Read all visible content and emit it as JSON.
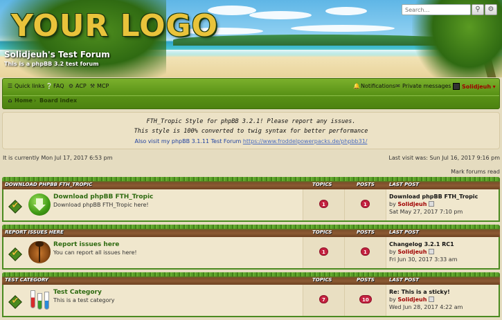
{
  "header": {
    "logo_text": "YOUR LOGO",
    "site_title": "Solidjeuh's Test Forum",
    "site_description": "This is a phpBB 3.2 test forum",
    "search_placeholder": "Search…"
  },
  "navbar": {
    "quick_links": "Quick links",
    "faq": "FAQ",
    "acp": "ACP",
    "mcp": "MCP",
    "notifications": "Notifications",
    "private_messages": "Private messages",
    "username": "Solidjeuh",
    "breadcrumb_home": "Home",
    "breadcrumb_index": "Board index"
  },
  "announcement": {
    "line1": "FTH_Tropic Style for phpBB 3.2.1! Please report any issues.",
    "line2": "This style is 100% converted to twig syntax for better performance",
    "line3_prefix": "Also visit my phpBB 3.1.11 Test Forum",
    "line3_link": "https://www.froddelpowerpacks.de/phpbb31/"
  },
  "info": {
    "current_time": "It is currently Mon Jul 17, 2017 6:53 pm",
    "last_visit": "Last visit was: Sun Jul 16, 2017 9:16 pm",
    "mark_read": "Mark forums read"
  },
  "columns": {
    "topics": "TOPICS",
    "posts": "POSTS",
    "last_post": "LAST POST"
  },
  "categories": [
    {
      "name": "DOWNLOAD PHPBB FTH_TROPIC",
      "forum_title": "Download phpBB FTH_Tropic",
      "forum_desc": "Download phpBB FTH_Tropic here!",
      "topics": "1",
      "posts": "1",
      "last_post_title": "Download phpBB FTH_Tropic",
      "by": "by",
      "author": "Solidjeuh",
      "time": "Sat May 27, 2017 7:10 pm",
      "icon": "download-icon"
    },
    {
      "name": "REPORT ISSUES HERE",
      "forum_title": "Report issues here",
      "forum_desc": "You can report all issues here!",
      "topics": "1",
      "posts": "1",
      "last_post_title": "Changelog 3.2.1 RC1",
      "by": "by",
      "author": "Solidjeuh",
      "time": "Fri Jun 30, 2017 3:33 am",
      "icon": "bug-icon"
    },
    {
      "name": "TEST CATEGORY",
      "forum_title": "Test Category",
      "forum_desc": "This is a test category",
      "topics": "7",
      "posts": "10",
      "last_post_title": "Re: This is a sticky!",
      "by": "by",
      "author": "Solidjeuh",
      "time": "Wed Jun 28, 2017 4:22 am",
      "icon": "test-tubes-icon"
    }
  ]
}
